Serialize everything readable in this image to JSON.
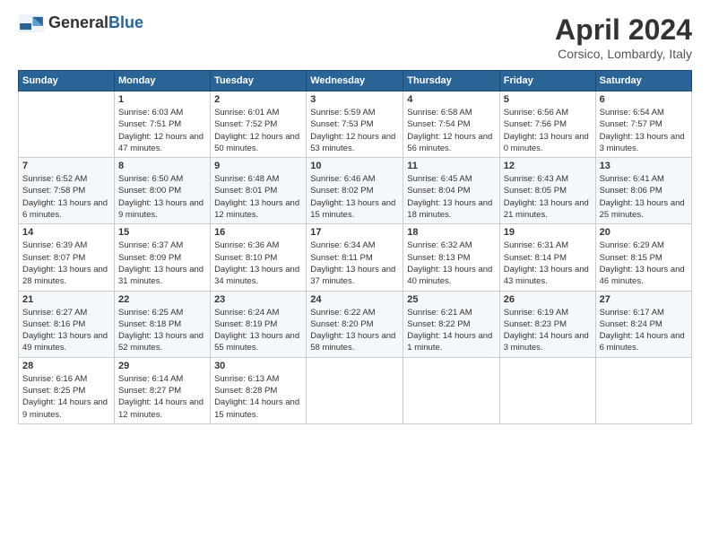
{
  "header": {
    "logo_general": "General",
    "logo_blue": "Blue",
    "month_year": "April 2024",
    "location": "Corsico, Lombardy, Italy"
  },
  "days_of_week": [
    "Sunday",
    "Monday",
    "Tuesday",
    "Wednesday",
    "Thursday",
    "Friday",
    "Saturday"
  ],
  "weeks": [
    [
      {
        "day": "",
        "sunrise": "",
        "sunset": "",
        "daylight": "",
        "empty": true
      },
      {
        "day": "1",
        "sunrise": "6:03 AM",
        "sunset": "7:51 PM",
        "daylight": "12 hours and 47 minutes."
      },
      {
        "day": "2",
        "sunrise": "6:01 AM",
        "sunset": "7:52 PM",
        "daylight": "12 hours and 50 minutes."
      },
      {
        "day": "3",
        "sunrise": "5:59 AM",
        "sunset": "7:53 PM",
        "daylight": "12 hours and 53 minutes."
      },
      {
        "day": "4",
        "sunrise": "6:58 AM",
        "sunset": "7:54 PM",
        "daylight": "12 hours and 56 minutes."
      },
      {
        "day": "5",
        "sunrise": "6:56 AM",
        "sunset": "7:56 PM",
        "daylight": "13 hours and 0 minutes."
      },
      {
        "day": "6",
        "sunrise": "6:54 AM",
        "sunset": "7:57 PM",
        "daylight": "13 hours and 3 minutes."
      }
    ],
    [
      {
        "day": "7",
        "sunrise": "6:52 AM",
        "sunset": "7:58 PM",
        "daylight": "13 hours and 6 minutes."
      },
      {
        "day": "8",
        "sunrise": "6:50 AM",
        "sunset": "8:00 PM",
        "daylight": "13 hours and 9 minutes."
      },
      {
        "day": "9",
        "sunrise": "6:48 AM",
        "sunset": "8:01 PM",
        "daylight": "13 hours and 12 minutes."
      },
      {
        "day": "10",
        "sunrise": "6:46 AM",
        "sunset": "8:02 PM",
        "daylight": "13 hours and 15 minutes."
      },
      {
        "day": "11",
        "sunrise": "6:45 AM",
        "sunset": "8:04 PM",
        "daylight": "13 hours and 18 minutes."
      },
      {
        "day": "12",
        "sunrise": "6:43 AM",
        "sunset": "8:05 PM",
        "daylight": "13 hours and 21 minutes."
      },
      {
        "day": "13",
        "sunrise": "6:41 AM",
        "sunset": "8:06 PM",
        "daylight": "13 hours and 25 minutes."
      }
    ],
    [
      {
        "day": "14",
        "sunrise": "6:39 AM",
        "sunset": "8:07 PM",
        "daylight": "13 hours and 28 minutes."
      },
      {
        "day": "15",
        "sunrise": "6:37 AM",
        "sunset": "8:09 PM",
        "daylight": "13 hours and 31 minutes."
      },
      {
        "day": "16",
        "sunrise": "6:36 AM",
        "sunset": "8:10 PM",
        "daylight": "13 hours and 34 minutes."
      },
      {
        "day": "17",
        "sunrise": "6:34 AM",
        "sunset": "8:11 PM",
        "daylight": "13 hours and 37 minutes."
      },
      {
        "day": "18",
        "sunrise": "6:32 AM",
        "sunset": "8:13 PM",
        "daylight": "13 hours and 40 minutes."
      },
      {
        "day": "19",
        "sunrise": "6:31 AM",
        "sunset": "8:14 PM",
        "daylight": "13 hours and 43 minutes."
      },
      {
        "day": "20",
        "sunrise": "6:29 AM",
        "sunset": "8:15 PM",
        "daylight": "13 hours and 46 minutes."
      }
    ],
    [
      {
        "day": "21",
        "sunrise": "6:27 AM",
        "sunset": "8:16 PM",
        "daylight": "13 hours and 49 minutes."
      },
      {
        "day": "22",
        "sunrise": "6:25 AM",
        "sunset": "8:18 PM",
        "daylight": "13 hours and 52 minutes."
      },
      {
        "day": "23",
        "sunrise": "6:24 AM",
        "sunset": "8:19 PM",
        "daylight": "13 hours and 55 minutes."
      },
      {
        "day": "24",
        "sunrise": "6:22 AM",
        "sunset": "8:20 PM",
        "daylight": "13 hours and 58 minutes."
      },
      {
        "day": "25",
        "sunrise": "6:21 AM",
        "sunset": "8:22 PM",
        "daylight": "14 hours and 1 minute."
      },
      {
        "day": "26",
        "sunrise": "6:19 AM",
        "sunset": "8:23 PM",
        "daylight": "14 hours and 3 minutes."
      },
      {
        "day": "27",
        "sunrise": "6:17 AM",
        "sunset": "8:24 PM",
        "daylight": "14 hours and 6 minutes."
      }
    ],
    [
      {
        "day": "28",
        "sunrise": "6:16 AM",
        "sunset": "8:25 PM",
        "daylight": "14 hours and 9 minutes."
      },
      {
        "day": "29",
        "sunrise": "6:14 AM",
        "sunset": "8:27 PM",
        "daylight": "14 hours and 12 minutes."
      },
      {
        "day": "30",
        "sunrise": "6:13 AM",
        "sunset": "8:28 PM",
        "daylight": "14 hours and 15 minutes."
      },
      {
        "day": "",
        "sunrise": "",
        "sunset": "",
        "daylight": "",
        "empty": true
      },
      {
        "day": "",
        "sunrise": "",
        "sunset": "",
        "daylight": "",
        "empty": true
      },
      {
        "day": "",
        "sunrise": "",
        "sunset": "",
        "daylight": "",
        "empty": true
      },
      {
        "day": "",
        "sunrise": "",
        "sunset": "",
        "daylight": "",
        "empty": true
      }
    ]
  ],
  "labels": {
    "sunrise_prefix": "Sunrise: ",
    "sunset_prefix": "Sunset: ",
    "daylight_prefix": "Daylight: "
  }
}
